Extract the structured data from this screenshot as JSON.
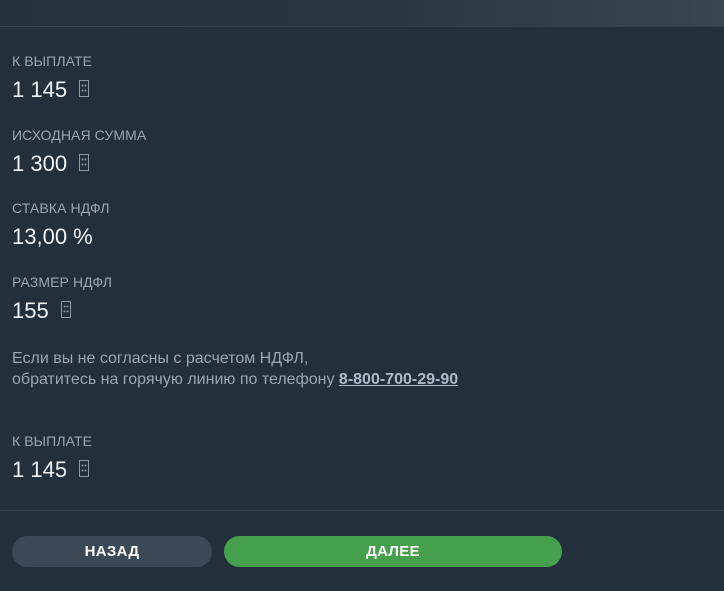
{
  "summary_top": {
    "label": "К ВЫПЛАТЕ",
    "value": "1 145"
  },
  "original_amount": {
    "label": "ИСХОДНАЯ СУММА",
    "value": "1 300"
  },
  "tax_rate": {
    "label": "СТАВКА НДФЛ",
    "value": "13,00 %"
  },
  "tax_amount": {
    "label": "РАЗМЕР НДФЛ",
    "value": "155"
  },
  "notice": {
    "line1": "Если вы не согласны с расчетом НДФЛ,",
    "line2": "обратитесь на горячую линию по телефону ",
    "phone": "8-800-700-29-90"
  },
  "summary_bottom": {
    "label": "К ВЫПЛАТЕ",
    "value": "1 145"
  },
  "buttons": {
    "back": "НАЗАД",
    "next": "ДАЛЕЕ"
  },
  "icons": {
    "currency": "currency-coin-icon"
  },
  "colors": {
    "background": "#232f3b",
    "label": "#9aa7b3",
    "value": "#eef2f5",
    "back_button": "#3b4856",
    "next_button": "#45a04d"
  }
}
